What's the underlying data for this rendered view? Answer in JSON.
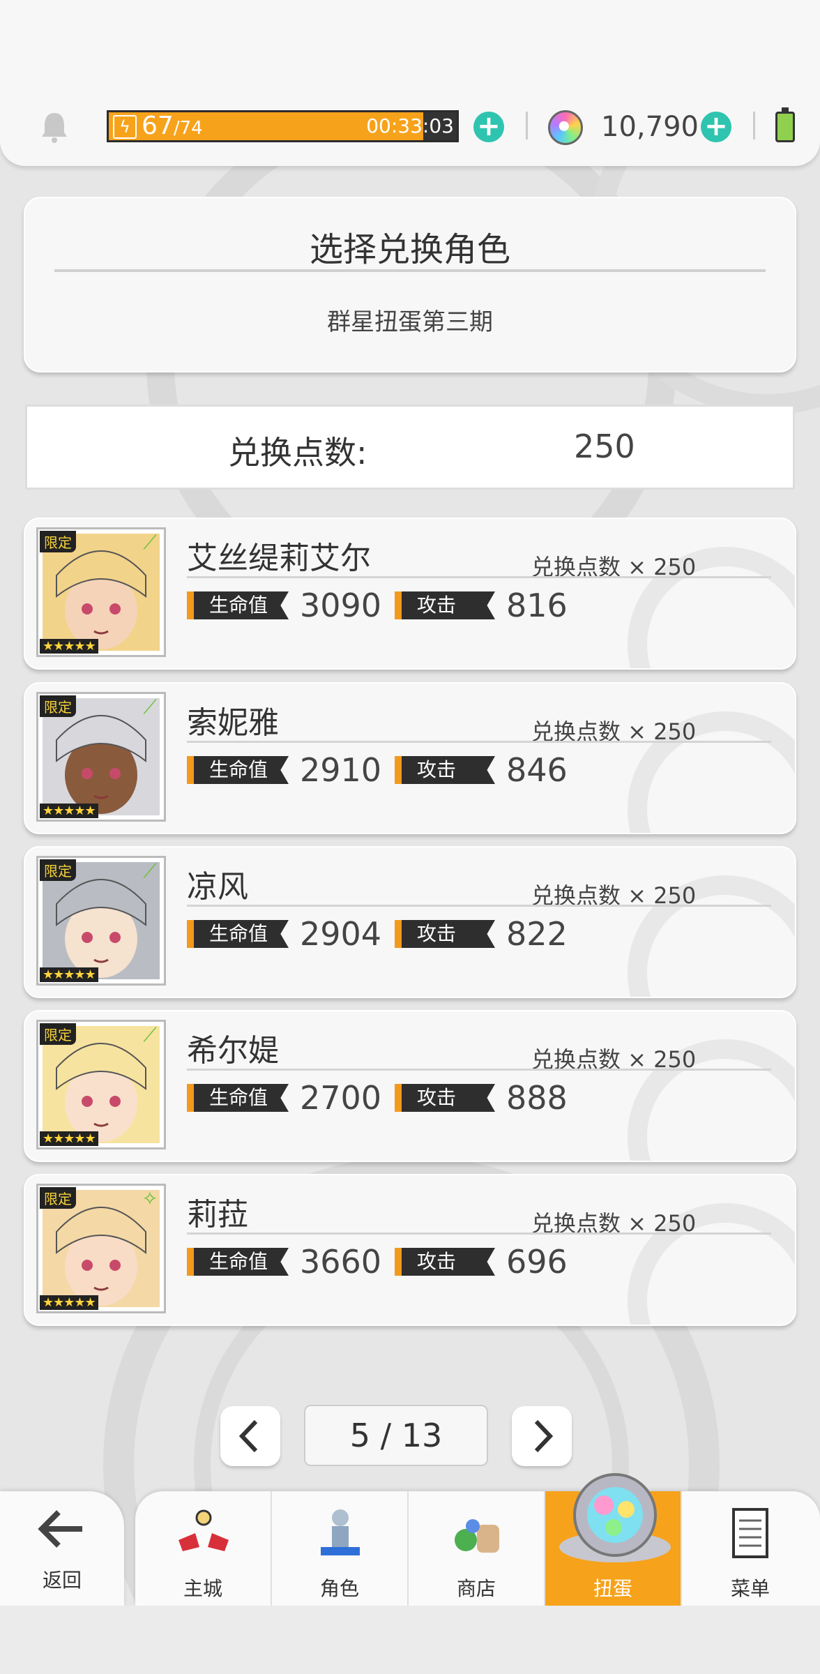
{
  "status_bar": {
    "stamina_current": "67",
    "stamina_max": "/74",
    "stamina_timer": "00:33:03",
    "gems": "10,790"
  },
  "header": {
    "title": "选择兑换角色",
    "subtitle": "群星扭蛋第三期"
  },
  "points": {
    "label": "兑换点数:",
    "value": "250"
  },
  "labels": {
    "hp": "生命值",
    "atk": "攻击",
    "limited": "限定",
    "stars": "★★★★★"
  },
  "characters": [
    {
      "name": "艾丝缇莉艾尔",
      "cost": "兑换点数 × 250",
      "hp": "3090",
      "atk": "816",
      "element": "wind",
      "hair": "#f2d38a",
      "skin": "#f5d3b8"
    },
    {
      "name": "索妮雅",
      "cost": "兑换点数 × 250",
      "hp": "2910",
      "atk": "846",
      "element": "wind",
      "hair": "#d8d8dc",
      "skin": "#8a5a3c"
    },
    {
      "name": "凉风",
      "cost": "兑换点数 × 250",
      "hp": "2904",
      "atk": "822",
      "element": "wind",
      "hair": "#b9bcc2",
      "skin": "#f5e2cf"
    },
    {
      "name": "希尔媞",
      "cost": "兑换点数 × 250",
      "hp": "2700",
      "atk": "888",
      "element": "wind",
      "hair": "#f7e3a0",
      "skin": "#f8e0cc"
    },
    {
      "name": "莉菈",
      "cost": "兑换点数 × 250",
      "hp": "3660",
      "atk": "696",
      "element": "light",
      "hair": "#f4d9a6",
      "skin": "#f8dcc6"
    }
  ],
  "pagination": {
    "current": "5 / 13",
    "prev_icon": "chevron-left-icon",
    "next_icon": "chevron-right-icon"
  },
  "nav": {
    "back_label": "返回",
    "items": [
      {
        "label": "主城",
        "icon": "castle-icon"
      },
      {
        "label": "角色",
        "icon": "character-icon"
      },
      {
        "label": "商店",
        "icon": "shop-icon"
      },
      {
        "label": "扭蛋",
        "icon": "gacha-icon",
        "active": true
      },
      {
        "label": "菜单",
        "icon": "menu-icon"
      }
    ]
  },
  "colors": {
    "accent": "#f7a21b",
    "teal": "#2ec4b0",
    "background": "#e6e6e6"
  }
}
